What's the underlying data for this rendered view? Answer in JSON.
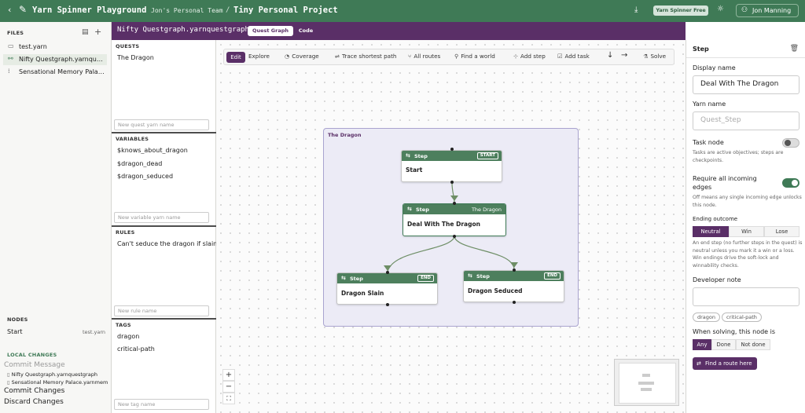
{
  "header": {
    "back_icon": "chevron-left-icon",
    "app_title": "Yarn Spinner Playground",
    "team": "Jon's Personal Team",
    "separator": "/",
    "project": "Tiny Personal Project",
    "download_icon": "download-icon",
    "plan_badge": "Yarn Spinner Free",
    "theme_icon": "sun-icon",
    "user_name": "Jon Manning",
    "colors": {
      "topbar": "#3f7a56",
      "tabbar": "#5a2f67"
    }
  },
  "tabbar": {
    "file_title": "Nifty Questgraph.yarnquestgraph",
    "tabs": [
      {
        "label": "Quest Graph",
        "active": true
      },
      {
        "label": "Code",
        "active": false
      }
    ]
  },
  "files": {
    "heading": "FILES",
    "items": [
      {
        "icon": "file-icon",
        "name": "test.yarn"
      },
      {
        "icon": "graph-icon",
        "name": "Nifty Questgraph.yarnquestgraph"
      },
      {
        "icon": "memory-palace-icon",
        "name": "Sensational Memory Palace.yarnmemorypalace"
      }
    ]
  },
  "nodes_section": {
    "heading": "NODES",
    "items": [
      {
        "name": "Start",
        "file": "test.yarn"
      }
    ]
  },
  "local_changes": {
    "heading": "LOCAL CHANGES",
    "commit_placeholder": "Commit Message",
    "files": [
      "Nifty Questgraph.yarnquestgraph",
      "Sensational Memory Palace.yarnmemorypalace"
    ],
    "commit_label": "Commit Changes",
    "discard_label": "Discard Changes"
  },
  "quests": {
    "heading": "QUESTS",
    "items": [
      "The Dragon"
    ],
    "placeholder": "New quest yarn name"
  },
  "variables": {
    "heading": "VARIABLES",
    "items": [
      "$knows_about_dragon",
      "$dragon_dead",
      "$dragon_seduced"
    ],
    "placeholder": "New variable yarn name"
  },
  "rules": {
    "heading": "RULES",
    "items": [
      "Can't seduce the dragon if slain"
    ],
    "placeholder": "New rule name"
  },
  "tags": {
    "heading": "TAGS",
    "items": [
      "dragon",
      "critical-path"
    ],
    "placeholder": "New tag name"
  },
  "toolbar": {
    "mode": [
      {
        "label": "Edit",
        "active": true
      },
      {
        "label": "Explore",
        "active": false
      }
    ],
    "actions": [
      {
        "label": "Coverage",
        "icon": "coverage-icon"
      },
      {
        "label": "Trace shortest path",
        "icon": "trace-icon"
      },
      {
        "label": "All routes",
        "icon": "routes-icon"
      },
      {
        "label": "Find a world",
        "icon": "world-icon"
      },
      {
        "label": "Add step",
        "icon": "add-step-icon"
      },
      {
        "label": "Add task",
        "icon": "add-task-icon"
      },
      {
        "label": "Solve",
        "icon": "flask-icon"
      }
    ]
  },
  "graph": {
    "group_label": "The Dragon",
    "nodes": [
      {
        "kind": "Step",
        "tag": "START",
        "title": "Start"
      },
      {
        "kind": "Step",
        "tag": "The Dragon",
        "title": "Deal With The Dragon"
      },
      {
        "kind": "Step",
        "tag": "END",
        "title": "Dragon Slain"
      },
      {
        "kind": "Step",
        "tag": "END",
        "title": "Dragon Seduced"
      }
    ]
  },
  "zoom": {
    "in": "+",
    "out": "−",
    "fit": "⛶"
  },
  "inspector": {
    "heading": "Step",
    "display_name_label": "Display name",
    "display_name_value": "Deal With The Dragon",
    "yarn_name_label": "Yarn name",
    "yarn_name_placeholder": "Quest_Step",
    "task_node_label": "Task node",
    "task_node_on": false,
    "task_node_help": "Tasks are active objectives; steps are checkpoints.",
    "require_label": "Require all incoming edges",
    "require_on": true,
    "require_help": "Off means any single incoming edge unlocks this node.",
    "ending_label": "Ending outcome",
    "ending_options": [
      "Neutral",
      "Win",
      "Lose"
    ],
    "ending_selected": "Neutral",
    "ending_help": "An end step (no further steps in the quest) is neutral unless you mark it a win or a loss. Win endings drive the soft-lock and winnability checks.",
    "dev_note_label": "Developer note",
    "note_tags": [
      "dragon",
      "critical-path"
    ],
    "solving_label": "When solving, this node is",
    "solving_options": [
      "Any",
      "Done",
      "Not done"
    ],
    "solving_selected": "Any",
    "find_route_label": "Find a route here"
  }
}
